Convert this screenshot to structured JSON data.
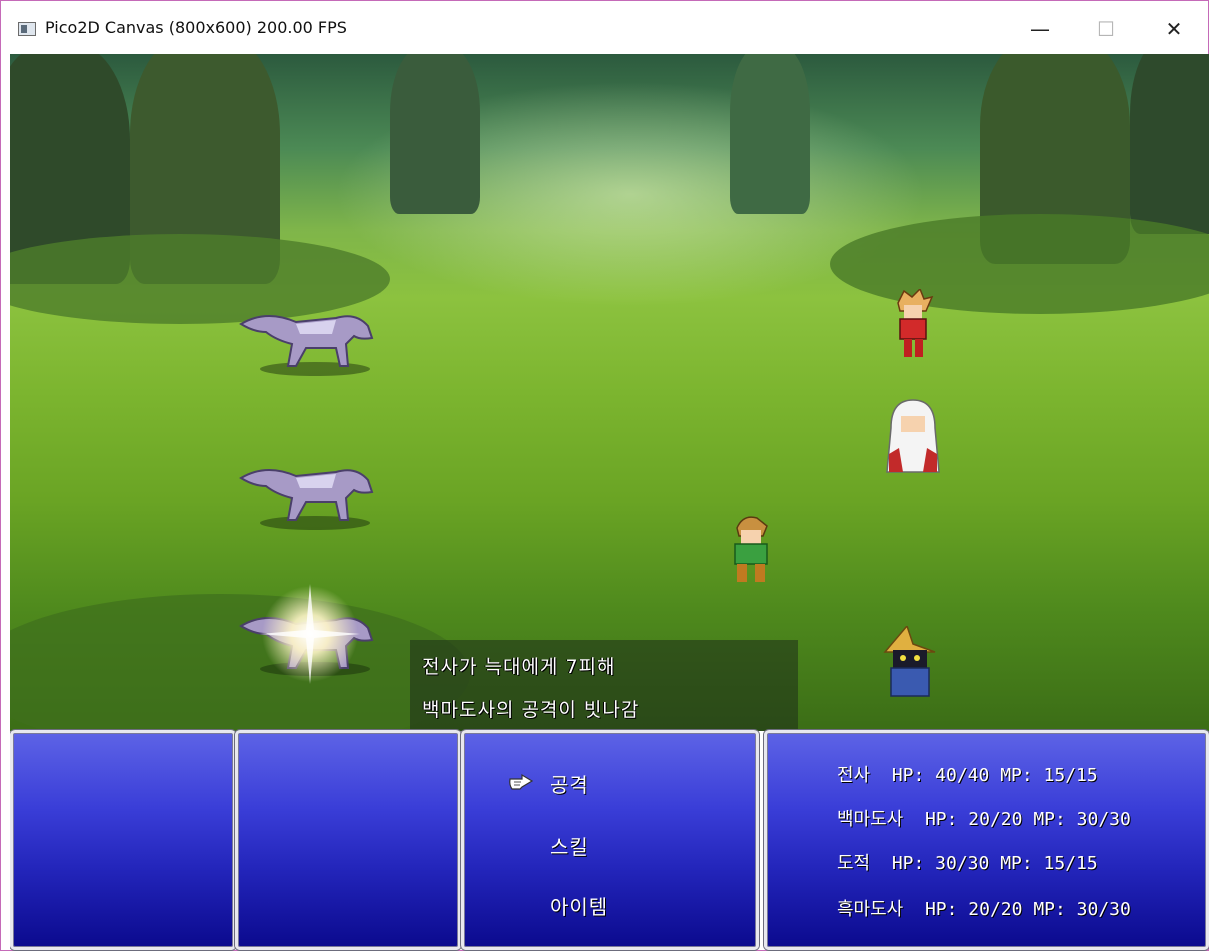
{
  "window": {
    "title": "Pico2D Canvas (800x600) 200.00 FPS",
    "minimize_glyph": "—",
    "maximize_glyph": "☐",
    "close_glyph": "✕"
  },
  "battle_log": {
    "line1": "전사가 늑대에게 7피해",
    "line2": "백마도사의 공격이 빗나감"
  },
  "command_menu": {
    "items": [
      "공격",
      "스킬",
      "아이템"
    ],
    "selected_index": 0,
    "cursor_icon": "pointing-hand-icon"
  },
  "party_status": [
    {
      "name": "전사",
      "hp": "HP: 40/40",
      "mp": "MP: 15/15"
    },
    {
      "name": "백마도사",
      "hp": "HP: 20/20",
      "mp": "MP: 30/30"
    },
    {
      "name": "도적",
      "hp": "HP: 30/30",
      "mp": "MP: 15/15"
    },
    {
      "name": "흑마도사",
      "hp": "HP: 20/20",
      "mp": "MP: 30/30"
    }
  ],
  "enemies": [
    "wolf",
    "wolf",
    "wolf"
  ],
  "colors": {
    "panel_top": "#5d63e6",
    "panel_bottom": "#0b0a8e",
    "panel_border": "#e8e8ee",
    "grass": "#8cc23f"
  }
}
